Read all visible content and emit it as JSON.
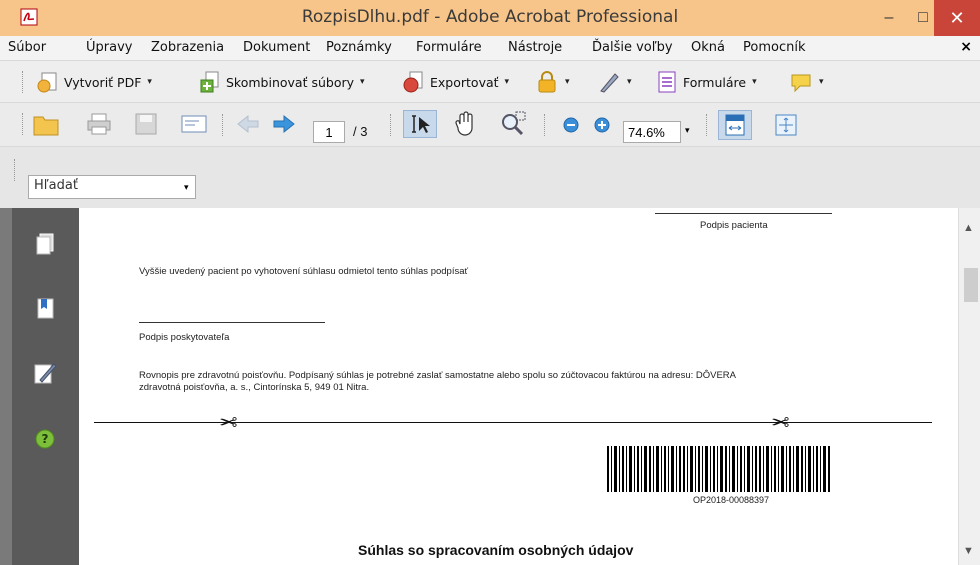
{
  "window": {
    "title": "RozpisDlhu.pdf - Adobe Acrobat Professional",
    "minimize_glyph": "–",
    "maximize_glyph": "□",
    "close_glyph": "✕"
  },
  "menu": {
    "items": [
      "Súbor",
      "Úpravy",
      "Zobrazenia",
      "Dokument",
      "Poznámky",
      "Formuláre",
      "Nástroje",
      "Ďalšie voľby",
      "Okná",
      "Pomocník"
    ],
    "close_glyph": "×"
  },
  "task_toolbar": {
    "create_pdf": "Vytvoriť PDF",
    "combine": "Skombinovať súbory",
    "export": "Exportovať",
    "forms": "Formuláre",
    "caret": "▾"
  },
  "nav_toolbar": {
    "current_page": "1",
    "page_total": "/ 3",
    "zoom": "74.6%",
    "caret": "▾"
  },
  "search": {
    "placeholder": "Hľadať",
    "caret": "▾"
  },
  "document": {
    "patient_signature": "Podpis pacienta",
    "refusal_note": "Vyššie uvedený pacient po vyhotovení súhlasu odmietol tento súhlas podpísať",
    "provider_signature": "Podpis poskytovateľa",
    "copy_note_line1": "Rovnopis pre zdravotnú poisťovňu. Podpísaný súhlas je potrebné zaslať samostatne alebo spolu so zúčtovacou faktúrou na adresu: DÔVERA",
    "copy_note_line2": "zdravotná poisťovňa, a. s., Cintorínska 5, 949 01 Nitra.",
    "scissors_glyph": "✂",
    "barcode_text": "OP2018-00088397",
    "section_heading": "Súhlas so spracovaním osobných údajov"
  },
  "scroll": {
    "up_glyph": "▲",
    "down_glyph": "▼"
  },
  "colors": {
    "titlebar": "#f7c58a",
    "close_button": "#c9453a",
    "sidepanel": "#5a5a5a"
  }
}
